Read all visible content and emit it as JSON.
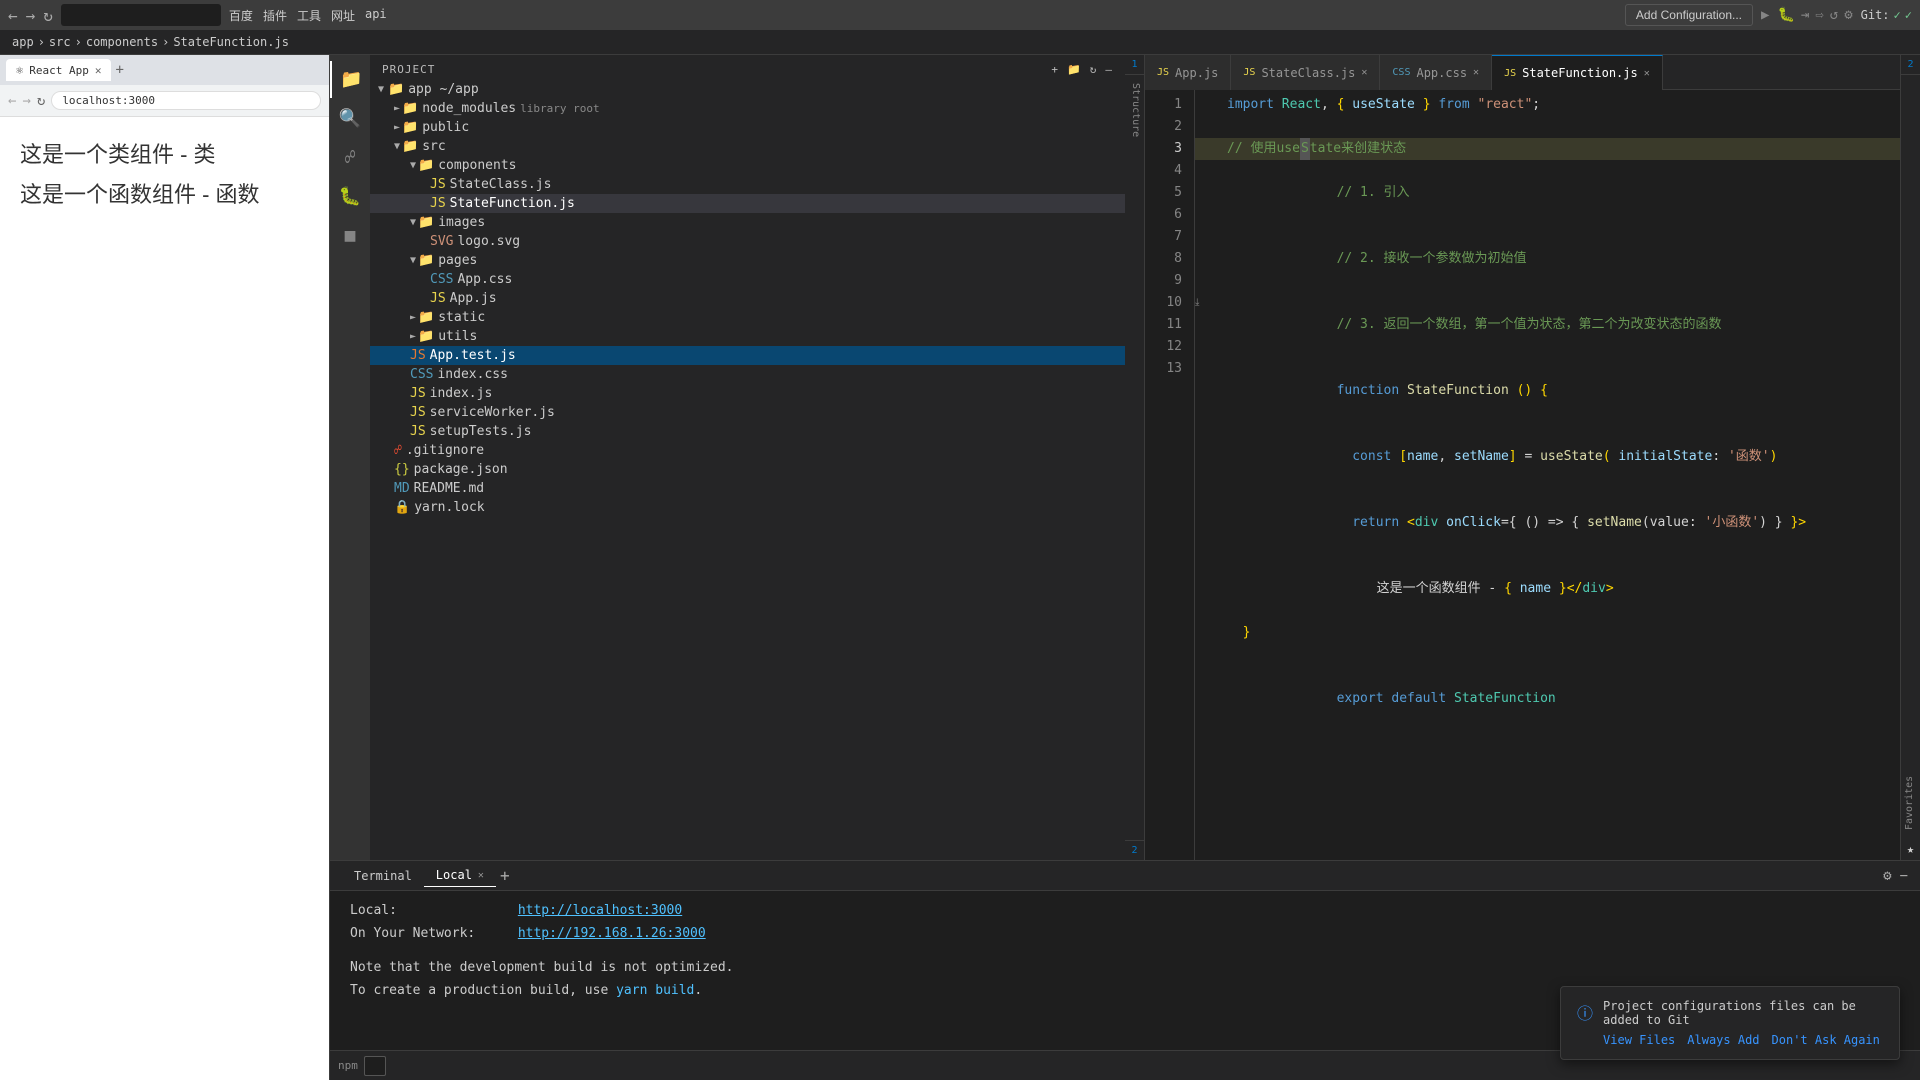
{
  "topbar": {
    "url": "localhost:3000",
    "add_config_label": "Add Configuration...",
    "git_label": "Git:",
    "menu_items": [
      "百度",
      "插件",
      "工具",
      "网址",
      "api"
    ]
  },
  "breadcrumb": {
    "parts": [
      "app",
      "src",
      "components",
      "StateFunction.js"
    ]
  },
  "tabs": [
    {
      "label": "App.js",
      "type": "js",
      "closable": false
    },
    {
      "label": "StateClass.js",
      "type": "js",
      "closable": true
    },
    {
      "label": "App.css",
      "type": "css",
      "closable": true
    },
    {
      "label": "StateFunction.js",
      "type": "js",
      "closable": true,
      "active": true
    }
  ],
  "explorer": {
    "project_label": "Project",
    "app_folder": "app  ~/app",
    "items": [
      {
        "name": "node_modules",
        "label": "library root",
        "type": "folder",
        "indent": 1
      },
      {
        "name": "public",
        "type": "folder",
        "indent": 1
      },
      {
        "name": "src",
        "type": "folder",
        "indent": 1,
        "open": true
      },
      {
        "name": "components",
        "type": "folder",
        "indent": 2,
        "open": true
      },
      {
        "name": "StateClass.js",
        "type": "js",
        "indent": 3
      },
      {
        "name": "StateFunction.js",
        "type": "js",
        "indent": 3,
        "active": true
      },
      {
        "name": "images",
        "type": "folder",
        "indent": 2,
        "open": true
      },
      {
        "name": "logo.svg",
        "type": "svg",
        "indent": 3
      },
      {
        "name": "pages",
        "type": "folder",
        "indent": 2,
        "open": true
      },
      {
        "name": "App.css",
        "type": "css",
        "indent": 3
      },
      {
        "name": "App.js",
        "type": "js",
        "indent": 3
      },
      {
        "name": "static",
        "type": "folder",
        "indent": 2
      },
      {
        "name": "utils",
        "type": "folder",
        "indent": 2
      },
      {
        "name": "App.test.js",
        "type": "test",
        "indent": 2,
        "highlighted": true
      },
      {
        "name": "index.css",
        "type": "css",
        "indent": 2
      },
      {
        "name": "index.js",
        "type": "js",
        "indent": 2
      },
      {
        "name": "serviceWorker.js",
        "type": "js",
        "indent": 2
      },
      {
        "name": "setupTests.js",
        "type": "js",
        "indent": 2
      },
      {
        "name": ".gitignore",
        "type": "git",
        "indent": 1
      },
      {
        "name": "package.json",
        "type": "json",
        "indent": 1
      },
      {
        "name": "README.md",
        "type": "md",
        "indent": 1
      },
      {
        "name": "yarn.lock",
        "type": "yarn",
        "indent": 1
      }
    ]
  },
  "code": {
    "lines": [
      {
        "num": 1,
        "content": "import_react"
      },
      {
        "num": 2,
        "content": "empty"
      },
      {
        "num": 3,
        "content": "comment_useState",
        "highlighted": true
      },
      {
        "num": 4,
        "content": "comment_1"
      },
      {
        "num": 5,
        "content": "comment_2"
      },
      {
        "num": 6,
        "content": "comment_3"
      },
      {
        "num": 7,
        "content": "function_decl"
      },
      {
        "num": 8,
        "content": "const_decl"
      },
      {
        "num": 9,
        "content": "return_jsx"
      },
      {
        "num": 10,
        "content": "close_div"
      },
      {
        "num": 11,
        "content": "empty"
      },
      {
        "num": 12,
        "content": "export_default"
      },
      {
        "num": 13,
        "content": "empty"
      }
    ]
  },
  "browser": {
    "tab_title": "React App",
    "url": "localhost:3000",
    "preview_class": "这是一个类组件 - 类",
    "preview_func": "这是一个函数组件 - 函数"
  },
  "terminal": {
    "tab_label": "Terminal",
    "local_tab": "Local",
    "local_url": "http://localhost:3000",
    "network_url": "http://192.168.1.26:3000",
    "note_line1": "Note that the development build is not optimized.",
    "note_line2": "To create a production build, use",
    "yarn_cmd": "yarn build",
    "note_end": "."
  },
  "notification": {
    "message": "Project configurations files can be added to Git",
    "view_files": "View Files",
    "always_add": "Always Add",
    "dont_ask": "Don't Ask Again"
  },
  "sidebar_labels": {
    "structure": "2. Structure",
    "favorites": "2. Favorites"
  }
}
